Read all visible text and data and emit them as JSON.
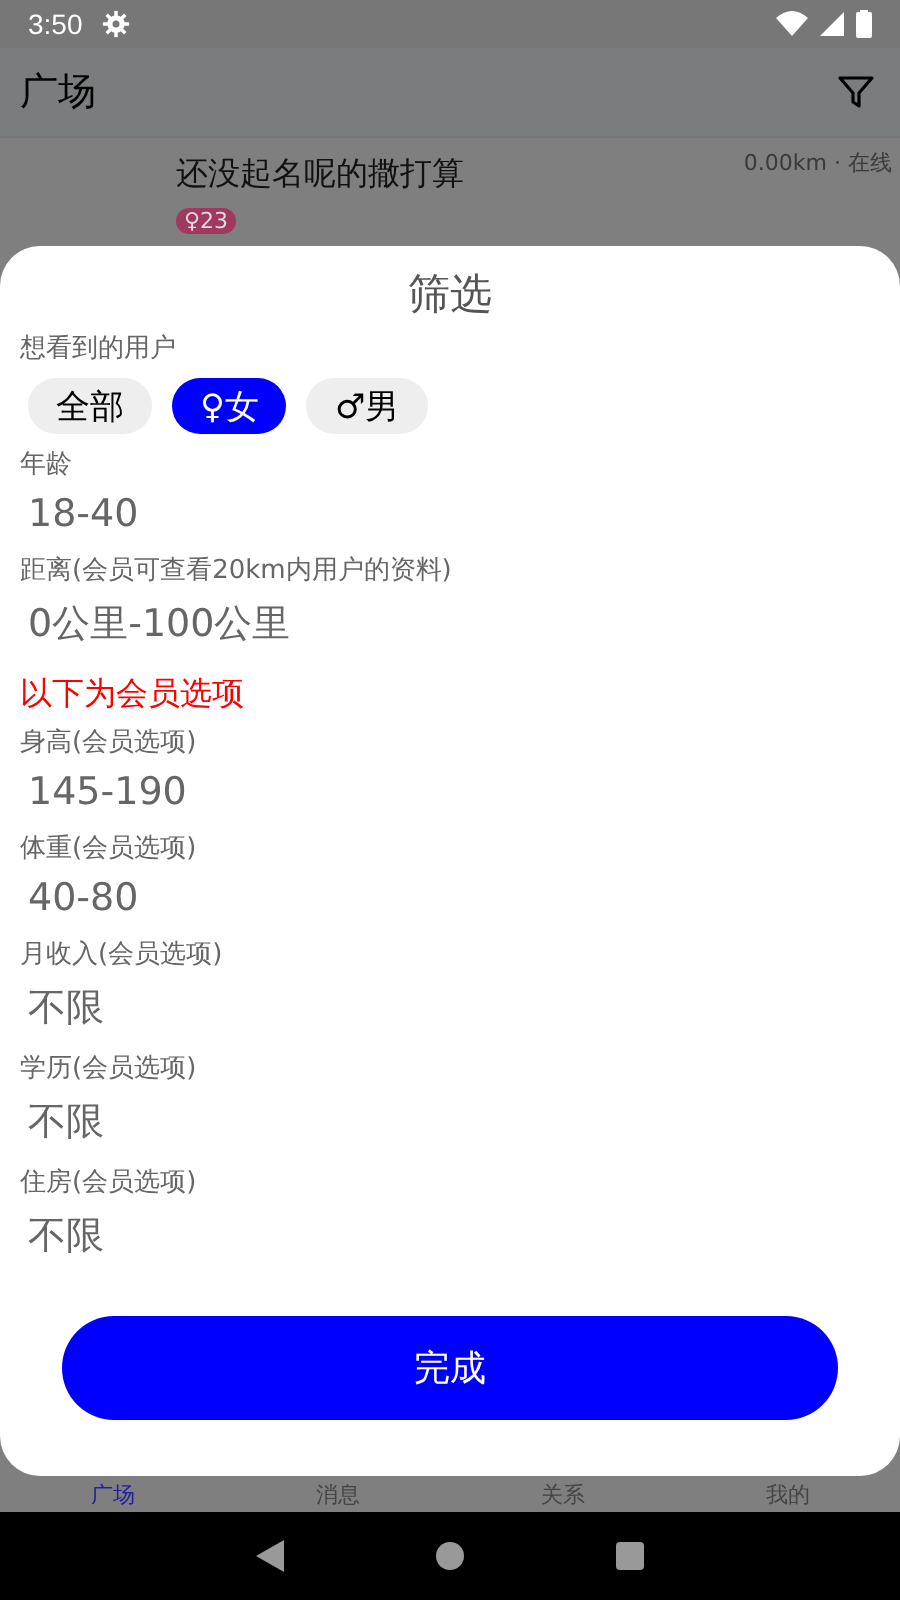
{
  "status_bar": {
    "time": "3:50"
  },
  "app_bar": {
    "title": "广场"
  },
  "list_item": {
    "name": "还没起名呢的撒打算",
    "meta": "0.00km · 在线",
    "badge": "♀23"
  },
  "sheet": {
    "title": "筛选",
    "gender_label": "想看到的用户",
    "chips": [
      {
        "label": "全部",
        "selected": false
      },
      {
        "label": "♀女",
        "selected": true
      },
      {
        "label": "♂男",
        "selected": false
      }
    ],
    "sections": [
      {
        "kind": "field",
        "label": "年龄",
        "value": "18-40"
      },
      {
        "kind": "field",
        "label": "距离(会员可查看20km内用户的资料)",
        "value": "0公里-100公里"
      },
      {
        "kind": "note",
        "text": "以下为会员选项"
      },
      {
        "kind": "field",
        "label": "身高(会员选项)",
        "value": "145-190"
      },
      {
        "kind": "field",
        "label": "体重(会员选项)",
        "value": "40-80"
      },
      {
        "kind": "field",
        "label": "月收入(会员选项)",
        "value": "不限"
      },
      {
        "kind": "field",
        "label": "学历(会员选项)",
        "value": "不限"
      },
      {
        "kind": "field",
        "label": "住房(会员选项)",
        "value": "不限"
      }
    ],
    "done_button": "完成"
  },
  "bottom_nav": [
    {
      "label": "广场",
      "selected": true
    },
    {
      "label": "消息",
      "selected": false
    },
    {
      "label": "关系",
      "selected": false
    },
    {
      "label": "我的",
      "selected": false
    }
  ]
}
